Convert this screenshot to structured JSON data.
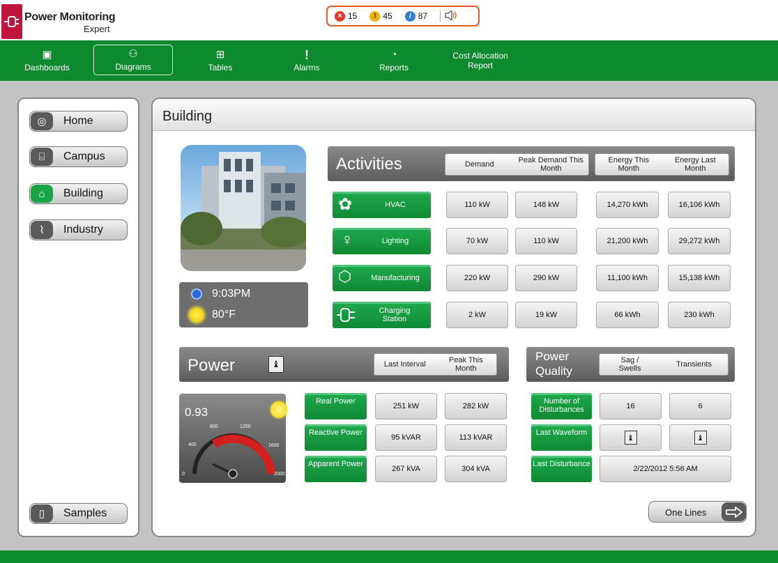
{
  "app": {
    "title_line1": "Power Monitoring",
    "title_line2": "Expert"
  },
  "alarm_counts": [
    {
      "icon": "error-icon",
      "value": "15",
      "color": "#e0372a"
    },
    {
      "icon": "warning-icon",
      "value": "45",
      "color": "#f0b400"
    },
    {
      "icon": "info-icon",
      "value": "87",
      "color": "#2f7fd8"
    }
  ],
  "nav": {
    "items": [
      {
        "label": "Dashboards",
        "icon": "dashboard-icon"
      },
      {
        "label": "Diagrams",
        "icon": "diagram-icon",
        "active": true
      },
      {
        "label": "Tables",
        "icon": "table-icon"
      },
      {
        "label": "Alarms",
        "icon": "alarm-icon"
      },
      {
        "label": "Reports",
        "icon": "reports-icon"
      },
      {
        "label": "Cost Allocation Report",
        "icon": ""
      }
    ]
  },
  "sidebar": {
    "items": [
      {
        "label": "Home",
        "icon": "globe-icon"
      },
      {
        "label": "Campus",
        "icon": "campus-icon"
      },
      {
        "label": "Building",
        "icon": "building-icon",
        "active": true
      },
      {
        "label": "Industry",
        "icon": "industry-icon"
      }
    ],
    "samples": "Samples"
  },
  "page": {
    "title": "Building"
  },
  "weather": {
    "time": "9:03PM",
    "temp": "80°F"
  },
  "activities": {
    "title": "Activities",
    "headers": {
      "demand": "Demand",
      "peak_demand": "Peak Demand This Month",
      "energy_this": "Energy This Month",
      "energy_last": "Energy Last Month"
    },
    "rows": [
      {
        "label": "HVAC",
        "icon": "fan-icon",
        "demand": "110 kW",
        "peak": "148 kW",
        "energy_this": "14,270 kWh",
        "energy_last": "16,106 kWh"
      },
      {
        "label": "Lighting",
        "icon": "lightbulb-icon",
        "demand": "70 kW",
        "peak": "110 kW",
        "energy_this": "21,200 kWh",
        "energy_last": "29,272 kWh"
      },
      {
        "label": "Manufacturing",
        "icon": "box-icon",
        "demand": "220 kW",
        "peak": "290 kW",
        "energy_this": "11,100 kWh",
        "energy_last": "15,138 kWh"
      },
      {
        "label": "Charging Station",
        "icon": "plug-icon",
        "demand": "2 kW",
        "peak": "19 kW",
        "energy_this": "66 kWh",
        "energy_last": "230 kWh"
      }
    ]
  },
  "power": {
    "title": "Power",
    "headers": {
      "last_interval": "Last Interval",
      "peak": "Peak This Month"
    },
    "power_factor": "0.93",
    "gauge_ticks": [
      "0",
      "400",
      "800",
      "1200",
      "1600",
      "2000"
    ],
    "rows": [
      {
        "label": "Real Power",
        "last": "251 kW",
        "peak": "282 kW"
      },
      {
        "label": "Reactive Power",
        "last": "95 kVAR",
        "peak": "113 kVAR"
      },
      {
        "label": "Apparent Power",
        "last": "267 kVA",
        "peak": "304 kVA"
      }
    ]
  },
  "quality": {
    "title_line1": "Power",
    "title_line2": "Quality",
    "headers": {
      "sag": "Sag / Swells",
      "transients": "Transients"
    },
    "rows": [
      {
        "label": "Number of Disturbances",
        "sag": "16",
        "transients": "6"
      },
      {
        "label": "Last Waveform"
      },
      {
        "label": "Last Disturbance",
        "value": "2/22/2012 5:56 AM"
      }
    ]
  },
  "one_lines": "One Lines"
}
